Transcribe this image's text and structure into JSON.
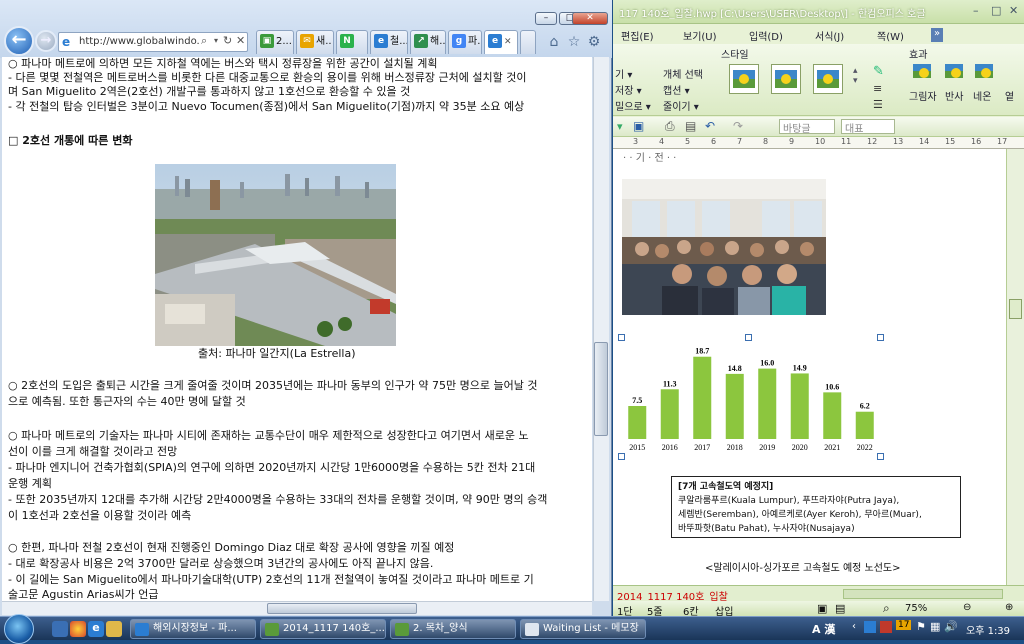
{
  "ie": {
    "address": "http://www.globalwindo...",
    "tabs": [
      {
        "label": "2...",
        "color": "#3b9a3b",
        "glyph": "▣"
      },
      {
        "label": "새..",
        "color": "#e8a400",
        "glyph": "✉"
      },
      {
        "label": "N",
        "color": "#2bb24c",
        "glyph": "N"
      },
      {
        "label": "철...",
        "color": "#2b7dd2",
        "glyph": "e"
      },
      {
        "label": "해..",
        "color": "#2f8f4e",
        "glyph": "↗"
      },
      {
        "label": "파..",
        "color": "#4285f4",
        "glyph": "g"
      },
      {
        "label": "",
        "color": "#2b7dd2",
        "glyph": "e"
      }
    ],
    "content": {
      "lines_top": [
        "○ 파나마 메트로에 의하면 모든 지하철 역에는 버스와 택시 정류장을 위한 공간이 설치될 계획",
        "- 다른 몇몇 전철역은 메트로버스를 비롯한 다른 대중교통으로 환승의 용이를 위해 버스정류장 근처에 설치할 것이",
        "  며 San Miguelito 2역은(2호선) 개발구를 통과하지 않고 1호선으로 환승할 수 있을 것",
        "- 각 전철의 탑승 인터벌은 3분이고 Nuevo Tocumen(종점)에서 San Miguelito(기점)까지 약 35분 소요 예상"
      ],
      "section_heading": "□ 2호선 개통에 따른 변화",
      "photo_caption": "출처: 파나마 일간지(La Estrella)",
      "lines_bottom": [
        "○ 2호선의 도입은 출퇴근 시간을 크게 줄여줄 것이며 2035년에는 파나마 동부의 인구가 약 75만 명으로 늘어날 것",
        "   으로 예측됨. 또한 통근자의 수는 40만 명에 달할 것",
        "",
        "○ 파나마 메트로의 기술자는 파나마 시티에 존재하는 교통수단이 매우 제한적으로 성장한다고 여기면서 새로운 노",
        "   선이 이를 크게 해결할 것이라고 전망",
        "- 파나마 엔지니어 건축가협회(SPIA)의 연구에 의하면 2020년까지 시간당 1만6000명을 수용하는 5칸 전차 21대",
        "   운행 계획",
        "- 또한 2035년까지 12대를 추가해 시간당 2만4000명을 수용하는 33대의 전차를 운행할 것이며, 약 90만 명의 승객",
        "   이 1호선과 2호선을 이용할 것이라 예측",
        "",
        "○ 한편, 파나마 전철 2호선이 현재 진행중인 Domingo Diaz 대로 확장 공사에 영향을 끼질 예정",
        "- 대로 확장공사 비용은 2억 3700만 달러로 상승했으며 3년간의 공사에도 아직 끝나지 않음.",
        "- 이 길에는 San Miguelito에서 파나마기술대학(UTP) 2호선의 11개 전철역이 놓여질 것이라고 파나마 메트로 기",
        "   술고문 Agustin Arias씨가 언급"
      ]
    }
  },
  "hwp": {
    "title": "117 140호_입찰.hwp [C:\\Users\\USER\\Desktop\\] - 한컴오피스 호글",
    "menus": [
      "편집(E)",
      "보기(U)",
      "입력(D)",
      "서식(J)",
      "쪽(W)"
    ],
    "ribbon": {
      "style_group": "스타일",
      "effect_group": "효과",
      "left_items": [
        "기 ▾",
        "저장 ▾",
        "밀으로 ▾"
      ],
      "object_items": [
        "개체 선택",
        "캡션 ▾",
        "줄이기 ▾"
      ],
      "effect_items": [
        "그림자",
        "반사",
        "네온",
        "옅"
      ]
    },
    "toolbar2": {
      "style_value": "바탕글",
      "para_value": "대표"
    },
    "ruler_marks": [
      "3",
      "4",
      "5",
      "6",
      "7",
      "8",
      "9",
      "10",
      "11",
      "12",
      "13",
      "14",
      "15",
      "16",
      "17"
    ],
    "page_top_text": "· · 기 · 전 · ·",
    "tab_label": "2014_1117 140호_입찰",
    "status": {
      "page": "1단",
      "line": "5줄",
      "col": "6칸",
      "mode": "삽입",
      "zoom": "75%"
    },
    "table": {
      "title": "[7개 고속철도역 예정지]",
      "rows": [
        "쿠알라룸푸르(Kuala Lumpur), 푸뜨라자야(Putra Jaya),",
        "세렘반(Seremban), 아예르케로(Ayer Keroh), 무아르(Muar),",
        "바뚜파핫(Batu Pahat), 누사자야(Nusajaya)"
      ]
    },
    "map_caption": "<말레이시아-싱가포르 고속철도 예정 노선도>"
  },
  "chart_data": {
    "type": "bar",
    "categories": [
      "2015",
      "2016",
      "2017",
      "2018",
      "2019",
      "2020",
      "2021",
      "2022"
    ],
    "values": [
      7.5,
      11.3,
      18.7,
      14.8,
      16.0,
      14.9,
      10.6,
      6.2
    ],
    "value_labels": [
      "7.5",
      "11.3",
      "18.7",
      "14.8",
      "16.0",
      "14.9",
      "10.6",
      "6.2"
    ],
    "ylim": [
      0,
      20
    ],
    "color": "#8cc63e",
    "title": "",
    "xlabel": "",
    "ylabel": ""
  },
  "taskbar": {
    "tasks": [
      {
        "label": "해외시장정보 - 파...",
        "color": "#2b7dd2"
      },
      {
        "label": "2014_1117 140호_...",
        "color": "#5a9a3a"
      },
      {
        "label": "2. 목차_양식",
        "color": "#5a9a3a"
      },
      {
        "label": "Waiting List - 메모장",
        "color": "#dfe6ef"
      }
    ],
    "lang": "A 漢",
    "time": "오후 1:39",
    "tray_badge": "17"
  }
}
